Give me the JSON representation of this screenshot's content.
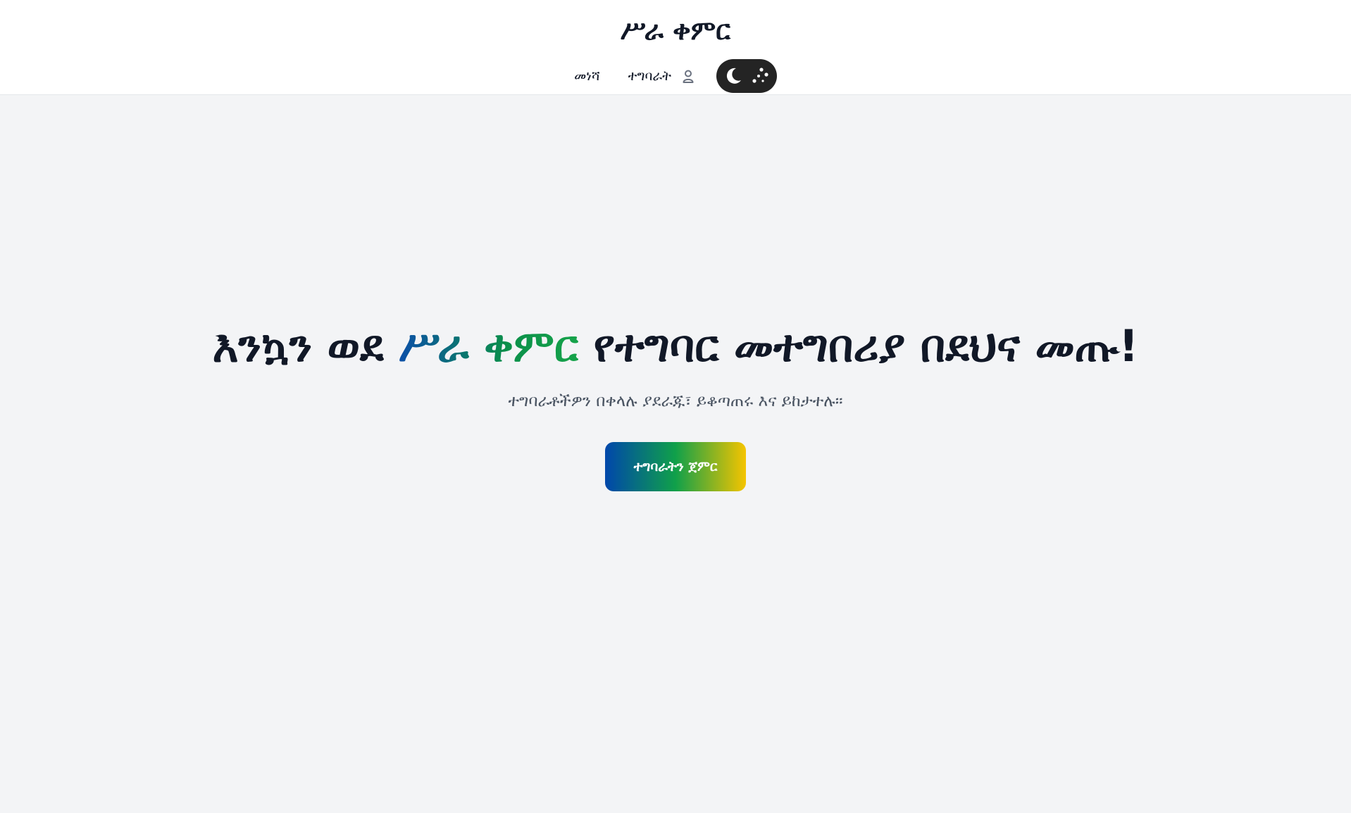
{
  "header": {
    "brand": "ሥራ ቀምር",
    "nav": {
      "home_label": "መነሻ",
      "tasks_label": "ተግባራት",
      "user_icon": "user-icon",
      "theme_toggle_icon": "moon-icon"
    }
  },
  "hero": {
    "title_before": "እንኳን ወደ ",
    "title_brand": "ሥራ ቀምር",
    "title_after": " የተግባር መተግበሪያ በደህና መጡ!",
    "subtitle": "ተግባራቶችዎን በቀላሉ ያደራጁ፣ ይቆጣጠሩ እና ይከታተሉ።",
    "cta_label": "ተግባራትን ጀምር"
  },
  "colors": {
    "background": "#f3f4f6",
    "header_bg": "#ffffff",
    "toggle_bg": "#242424",
    "brand_gradient_start": "#0047ab",
    "brand_gradient_mid": "#10a04a",
    "brand_gradient_end": "#f5c400"
  }
}
